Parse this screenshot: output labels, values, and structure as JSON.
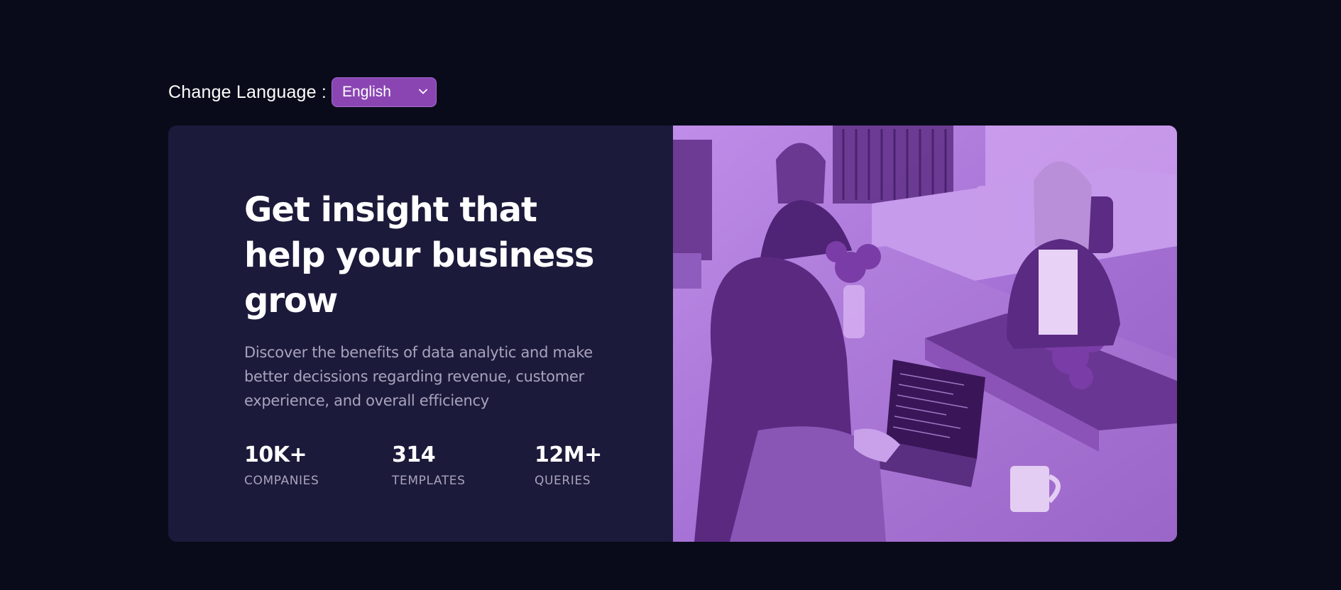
{
  "language": {
    "label": "Change Language :",
    "selected": "English"
  },
  "hero": {
    "headline": "Get insight that help your business grow",
    "description": "Discover the benefits of data analytic and make better decissions regarding revenue, customer experience, and overall efficiency",
    "stats": [
      {
        "value": "10K+",
        "label": "COMPANIES"
      },
      {
        "value": "314",
        "label": "TEMPLATES"
      },
      {
        "value": "12M+",
        "label": "QUERIES"
      }
    ]
  },
  "colors": {
    "page_background": "#090b1a",
    "card_background": "#1c1a3a",
    "accent": "#8a45b3",
    "image_tint": "#aa72dd",
    "muted_text": "#a8a3bd",
    "text": "#ffffff"
  },
  "image": {
    "icon": "office-team-photo"
  }
}
